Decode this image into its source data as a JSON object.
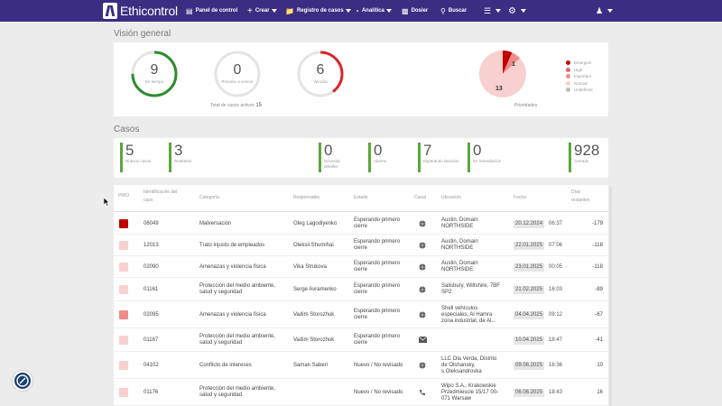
{
  "app": {
    "brand": "Ethicontrol"
  },
  "nav": {
    "dashboard": "Panel de control",
    "create": "Crear",
    "cases_registry": "Registro de casos",
    "analytics": "Analítica",
    "dossier": "Dosier",
    "search": "Buscar"
  },
  "overview": {
    "title": "Visión general",
    "gauges": [
      {
        "value": "9",
        "label": "En tiempo",
        "fraction": 0.75,
        "color": "#2e8b2e"
      },
      {
        "value": "0",
        "label": "Próximo a vencer",
        "fraction": 0,
        "color": "#cccccc"
      },
      {
        "value": "6",
        "label": "Vencido",
        "fraction": 0.4,
        "color": "#d9262b"
      }
    ],
    "total_label": "Total de casos activos",
    "total_value": "15",
    "priorities_label": "Prioridades",
    "pie": {
      "label_emergent": "1",
      "label_normal": "13"
    },
    "legend": [
      {
        "label": "Emergent",
        "color": "#c00000"
      },
      {
        "label": "High",
        "color": "#e06666"
      },
      {
        "label": "Important",
        "color": "#f08b8b"
      },
      {
        "label": "Normal",
        "color": "#f8d0d0"
      },
      {
        "label": "Undefined",
        "color": "#bdbdbd"
      }
    ]
  },
  "cases": {
    "title": "Casos",
    "stats": [
      {
        "value": "5",
        "label": "Nuevos casos",
        "color": "#5aa83c"
      },
      {
        "value": "3",
        "label": "Reabierto",
        "color": "#5aa83c"
      },
      {
        "value": "0",
        "label": "Necesita detalles",
        "color": "#5aa83c"
      },
      {
        "value": "0",
        "label": "Abierto",
        "color": "#5aa83c"
      },
      {
        "value": "7",
        "label": "Esperando decisión",
        "color": "#5aa83c"
      },
      {
        "value": "0",
        "label": "En remediación",
        "color": "#5aa83c"
      },
      {
        "value": "928",
        "label": "Cerrado",
        "color": "#5aa83c"
      }
    ]
  },
  "table": {
    "headers": {
      "pri": "PRIO",
      "id": "Identificación del caso",
      "category": "Categoría",
      "responsible": "Responsable",
      "status": "Estado",
      "channel": "Canal",
      "location": "Ubicación",
      "date": "Fecha",
      "days": "Días restantes"
    },
    "rows": [
      {
        "color": "#c00000",
        "id": "06049",
        "category": "Malversación",
        "responsible": "Oleg Lagodiyenko",
        "status": "Esperando primero cierre",
        "channel": "globe-icon",
        "location": "Austin, Domain NORTHSIDE",
        "date": "20.12.2024",
        "time": "06:37",
        "days": "-179"
      },
      {
        "color": "#f8d0d0",
        "id": "12013",
        "category": "Trato injusto de empleados",
        "responsible": "Oleksii Shumihai",
        "status": "Esperando primero cierre",
        "channel": "globe-icon",
        "location": "Austin, Domain NORTHSIDE",
        "date": "22.01.2025",
        "time": "07:06",
        "days": "-118"
      },
      {
        "color": "#f8d0d0",
        "id": "02090",
        "category": "Amenazas y violencia física",
        "responsible": "Vika Strukova",
        "status": "Esperando primero cierre",
        "channel": "globe-icon",
        "location": "Austin, Domain NORTHSIDE",
        "date": "23.01.2025",
        "time": "00:05",
        "days": "-118"
      },
      {
        "color": "#f8d0d0",
        "id": "01161",
        "category": "Protección del medio ambiente, salud y seguridad",
        "responsible": "Serge Avramenko",
        "status": "Esperando primero cierre",
        "channel": "globe-icon",
        "location": "Salisbury, Wiltshire, 7BF SP2",
        "date": "21.02.2025",
        "time": "16:03",
        "days": "-89"
      },
      {
        "color": "#f08b8b",
        "id": "02095",
        "category": "Amenazas y violencia física",
        "responsible": "Vadim Storozhuk",
        "status": "Esperando primero cierre",
        "channel": "globe-icon",
        "location": "Shell vehículos especiales, Al Hamra zona industrial, de Al...",
        "date": "04.04.2025",
        "time": "09:12",
        "days": "-67"
      },
      {
        "color": "#f8d0d0",
        "id": "01167",
        "category": "Protección del medio ambiente, salud y seguridad",
        "responsible": "Vadim Storozhuk",
        "status": "Esperando primero cierre",
        "channel": "envelope-icon",
        "location": "",
        "date": "10.04.2025",
        "time": "18:47",
        "days": "-41"
      },
      {
        "color": "#f8d0d0",
        "id": "04102",
        "category": "Conflicto de intereses",
        "responsible": "Saman Saberi",
        "status": "Nuevo / No revisado",
        "channel": "globe-icon",
        "location": "LLC Ola Verda, Distrito de Olshansky, s.Oleksandrovka",
        "date": "09.06.2025",
        "time": "16:36",
        "days": "10"
      },
      {
        "color": "#f8d0d0",
        "id": "01176",
        "category": "Protección del medio ambiente, salud y seguridad",
        "responsible": "",
        "status": "Nuevo / No revisado",
        "channel": "phone-icon",
        "location": "Wipo S.A., Krakowskie Przedmiescie 15/17 00-071 Warsaw",
        "date": "06.06.2025",
        "time": "18:43",
        "days": "16"
      }
    ]
  }
}
